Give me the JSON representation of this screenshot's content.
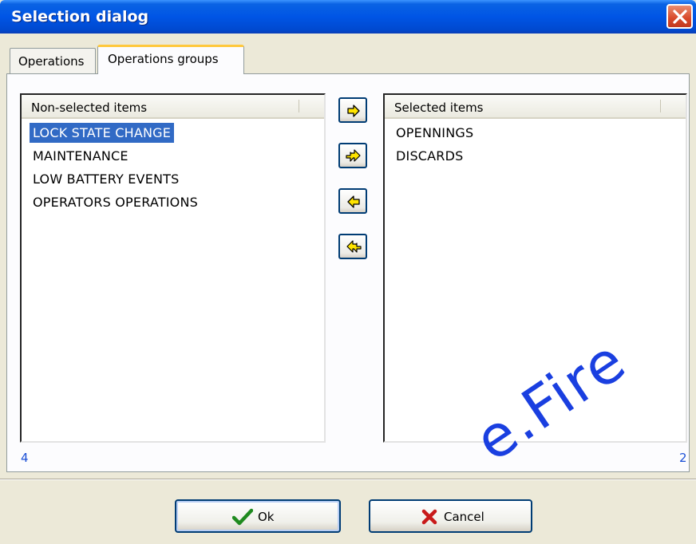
{
  "window": {
    "title": "Selection dialog"
  },
  "tabs": [
    {
      "label": "Operations",
      "active": false
    },
    {
      "label": "Operations groups",
      "active": true
    }
  ],
  "left_list": {
    "header": "Non-selected items",
    "items": [
      "LOCK STATE CHANGE",
      "MAINTENANCE",
      "LOW BATTERY EVENTS",
      "OPERATORS OPERATIONS"
    ],
    "selected_index": 0,
    "count": "4"
  },
  "right_list": {
    "header": "Selected items",
    "items": [
      "OPENNINGS",
      "DISCARDS"
    ],
    "count": "2"
  },
  "transfer_buttons": [
    "arrow-right-icon",
    "double-arrow-right-icon",
    "arrow-left-icon",
    "double-arrow-left-icon"
  ],
  "buttons": {
    "ok": "Ok",
    "cancel": "Cancel"
  },
  "watermark": "e.Fire",
  "colors": {
    "titlebar": "#0055e5",
    "selection": "#316ac5",
    "count_text": "#1b4fd6",
    "arrow_fill": "#ffe400"
  }
}
